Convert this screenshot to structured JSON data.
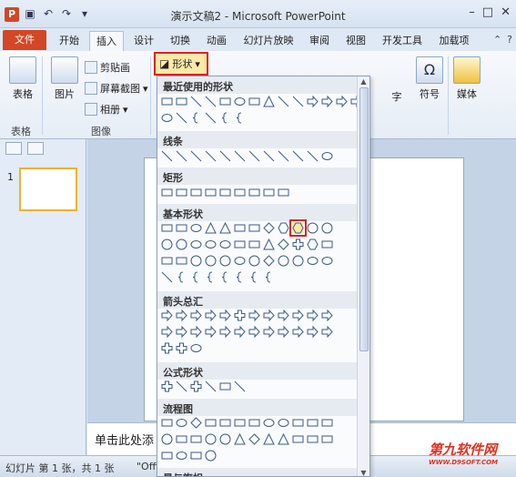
{
  "window": {
    "title": "演示文稿2 - Microsoft PowerPoint",
    "logo": "P"
  },
  "tabs": [
    "文件",
    "开始",
    "插入",
    "设计",
    "切换",
    "动画",
    "幻灯片放映",
    "审阅",
    "视图",
    "开发工具",
    "加载项"
  ],
  "ribbon": {
    "table_label": "表格",
    "table_group": "表格",
    "picture_label": "图片",
    "clipart_label": "剪贴画",
    "screenshot_label": "屏幕截图",
    "album_label": "相册",
    "images_group": "图像",
    "shapes_label": "形状",
    "symbol_label": "符号",
    "media_label": "媒体",
    "zi_label": "字"
  },
  "dropdown": {
    "sections": [
      {
        "title": "最近使用的形状"
      },
      {
        "title": "线条"
      },
      {
        "title": "矩形"
      },
      {
        "title": "基本形状"
      },
      {
        "title": "箭头总汇"
      },
      {
        "title": "公式形状"
      },
      {
        "title": "流程图"
      },
      {
        "title": "星与旗帜"
      }
    ]
  },
  "notes": {
    "placeholder": "单击此处添"
  },
  "status": {
    "slide_info": "幻灯片 第 1 张，共 1 张",
    "theme": "\"Offi"
  },
  "slides": [
    {
      "number": "1"
    }
  ],
  "watermark": {
    "main": "第九软件网",
    "sub": "WWW.D9SOFT.COM"
  }
}
